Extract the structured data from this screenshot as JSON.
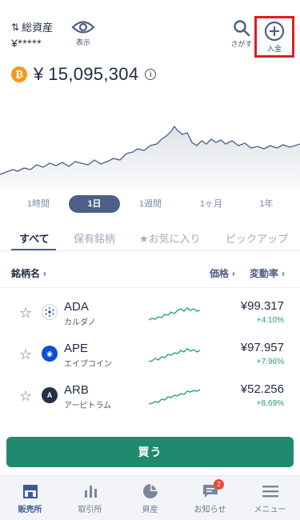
{
  "header": {
    "assets_label": "総資産",
    "assets_value": "¥*****",
    "show_label": "表示",
    "search_label": "さがす",
    "deposit_label": "入金"
  },
  "balance": {
    "coin_symbol": "₿",
    "currency": "¥",
    "amount": "15,095,304",
    "info_glyph": "i"
  },
  "periods": [
    "1時間",
    "1日",
    "1週間",
    "1ヶ月",
    "1年"
  ],
  "active_period": "1日",
  "tabs": [
    "すべて",
    "保有銘柄",
    "★お気に入り",
    "ピックアップ"
  ],
  "list_header": {
    "name": "銘柄名",
    "price": "価格",
    "change": "変動率",
    "sort_glyph": "⬍"
  },
  "coins": [
    {
      "symbol": "ADA",
      "name": "カルダノ",
      "price": "¥99.317",
      "change": "+4.10%",
      "icon_color": "#ffffff",
      "icon_name": "cardano-icon"
    },
    {
      "symbol": "APE",
      "name": "エイプコイン",
      "price": "¥97.957",
      "change": "+7.96%",
      "icon_color": "#0a4fd6",
      "icon_name": "apecoin-icon"
    },
    {
      "symbol": "ARB",
      "name": "アービトラム",
      "price": "¥52.256",
      "change": "+8.69%",
      "icon_color": "#213147",
      "icon_name": "arbitrum-icon"
    }
  ],
  "buy_label": "買う",
  "bottom_nav": [
    {
      "label": "販売所",
      "icon": "store-icon",
      "active": true
    },
    {
      "label": "取引所",
      "icon": "bar-chart-icon",
      "active": false
    },
    {
      "label": "資産",
      "icon": "pie-chart-icon",
      "active": false
    },
    {
      "label": "お知らせ",
      "icon": "message-icon",
      "active": false,
      "badge": "2"
    },
    {
      "label": "メニュー",
      "icon": "menu-icon",
      "active": false
    }
  ],
  "colors": {
    "accent": "#4d5f86",
    "buy": "#1f8a6d",
    "positive": "#1f9d7a",
    "btc": "#f39a1e",
    "highlight": "#e01b24"
  }
}
